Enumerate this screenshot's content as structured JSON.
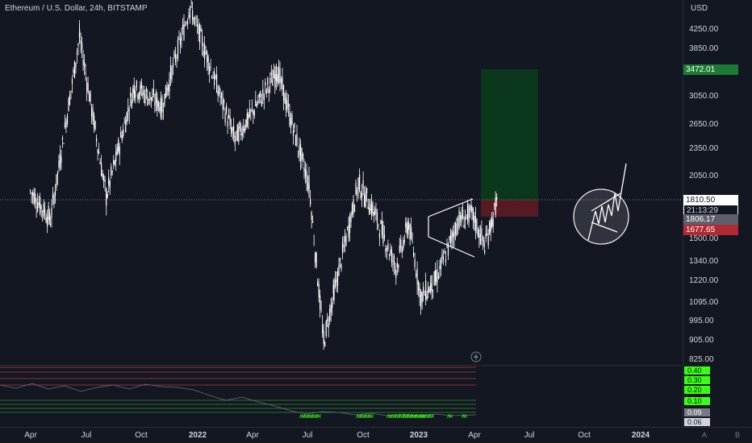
{
  "header": {
    "title": "Ethereum / U.S. Dollar, 24h, BITSTAMP"
  },
  "price_axis": {
    "currency": "USD",
    "ticks": [
      "4250.00",
      "3850.00",
      "3050.00",
      "2650.00",
      "2350.00",
      "2050.00",
      "1500.00",
      "1340.00",
      "1220.00",
      "1095.00",
      "995.00",
      "905.00",
      "825.00"
    ],
    "current_price": "1810.50",
    "countdown": "21:13:29",
    "target_price": "3472.01",
    "second_price": "1806.17",
    "stop_price": "1677.65"
  },
  "time_axis": {
    "ticks": [
      "Apr",
      "Jul",
      "Oct",
      "2022",
      "Apr",
      "Jul",
      "Oct",
      "2023",
      "Apr",
      "Jul",
      "Oct",
      "2024"
    ],
    "bold": [
      false,
      false,
      false,
      true,
      false,
      false,
      false,
      true,
      false,
      false,
      false,
      true
    ]
  },
  "indicator": {
    "levels": [
      "0.40",
      "0.30",
      "0.20",
      "0.10",
      "0.09",
      "0.06"
    ]
  },
  "nav": {
    "auto_label": "A",
    "log_label": "B"
  },
  "colors": {
    "background": "#131722",
    "candle": "#ffffff",
    "profit_zone": "#0b3a1d",
    "loss_zone": "#5a1a24",
    "target_badge": "#1b7a34",
    "stop_badge": "#b22833",
    "indicator_green": "#39ff14",
    "indicator_red": "#b53a3a"
  },
  "chart_data": {
    "type": "candlestick",
    "symbol": "Ethereum / U.S. Dollar",
    "interval": "24h",
    "exchange": "BITSTAMP",
    "anchors": [
      {
        "date": "2021-02-20",
        "price": 1900
      },
      {
        "date": "2021-03-25",
        "price": 1650
      },
      {
        "date": "2021-05-12",
        "price": 4100
      },
      {
        "date": "2021-06-25",
        "price": 1850
      },
      {
        "date": "2021-08-10",
        "price": 3200
      },
      {
        "date": "2021-09-25",
        "price": 2900
      },
      {
        "date": "2021-11-10",
        "price": 4750
      },
      {
        "date": "2022-01-23",
        "price": 2450
      },
      {
        "date": "2022-04-03",
        "price": 3450
      },
      {
        "date": "2022-05-25",
        "price": 1950
      },
      {
        "date": "2022-06-18",
        "price": 900
      },
      {
        "date": "2022-07-05",
        "price": 1150
      },
      {
        "date": "2022-08-14",
        "price": 1980
      },
      {
        "date": "2022-09-10",
        "price": 1700
      },
      {
        "date": "2022-10-15",
        "price": 1300
      },
      {
        "date": "2022-11-05",
        "price": 1620
      },
      {
        "date": "2022-11-25",
        "price": 1120
      },
      {
        "date": "2022-12-20",
        "price": 1220
      },
      {
        "date": "2023-01-25",
        "price": 1640
      },
      {
        "date": "2023-02-17",
        "price": 1700
      },
      {
        "date": "2023-03-10",
        "price": 1450
      },
      {
        "date": "2023-03-31",
        "price": 1810
      }
    ],
    "last_price": 1810.5,
    "position": {
      "entry": 1810.5,
      "target": 3472.01,
      "stop": 1677.65
    }
  }
}
